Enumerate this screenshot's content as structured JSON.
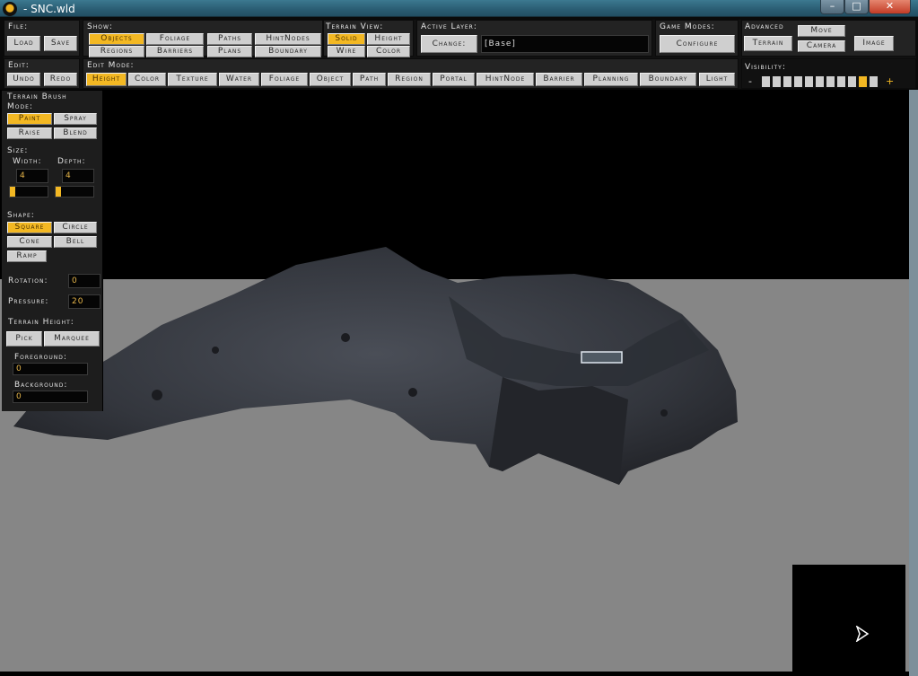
{
  "window": {
    "title": "- SNC.wld",
    "min": "–",
    "max": "□",
    "close": "✕",
    "app_icon": "game-logo-icon"
  },
  "file": {
    "label": "File:",
    "load": "Load",
    "save": "Save"
  },
  "show": {
    "label": "Show:",
    "buttons": [
      "Objects",
      "Foliage",
      "Paths",
      "HintNodes",
      "Regions",
      "Barriers",
      "Plans",
      "Boundary"
    ],
    "active": "Objects"
  },
  "terrain_view": {
    "label": "Terrain View:",
    "buttons": [
      "Solid",
      "Height",
      "Wire",
      "Color"
    ],
    "active": "Solid"
  },
  "active_layer": {
    "label": "Active Layer:",
    "change": "Change:",
    "value": "[Base]"
  },
  "game_modes": {
    "label": "Game Modes:",
    "configure": "Configure"
  },
  "advanced": {
    "label": "Advanced",
    "terrain": "Terrain",
    "move": "Move",
    "camera": "Camera",
    "image": "Image"
  },
  "edit": {
    "label": "Edit:",
    "undo": "Undo",
    "redo": "Redo"
  },
  "edit_mode": {
    "label": "Edit Mode:",
    "buttons": [
      "Height",
      "Color",
      "Texture",
      "Water",
      "Foliage",
      "Object",
      "Path",
      "Region",
      "Portal",
      "HintNode",
      "Barrier",
      "Planning",
      "Boundary",
      "Light"
    ],
    "active": "Height"
  },
  "visibility": {
    "label": "Visibility:",
    "minus": "-",
    "plus": "+",
    "level": 10,
    "steps": 11
  },
  "brush": {
    "title": "Terrain Brush",
    "mode_label": "Mode:",
    "modes": [
      "Paint",
      "Spray",
      "Raise",
      "Blend"
    ],
    "active_mode": "Paint",
    "size_label": "Size:",
    "width_label": "Width:",
    "depth_label": "Depth:",
    "width": "4",
    "depth": "4",
    "shape_label": "Shape:",
    "shapes": [
      "Square",
      "Circle",
      "Cone",
      "Bell",
      "Ramp"
    ],
    "active_shape": "Square",
    "rotation_label": "Rotation:",
    "rotation": "0",
    "pressure_label": "Pressure:",
    "pressure": "20",
    "height_label": "Terrain Height:",
    "pick": "Pick",
    "marquee": "Marquee",
    "fg_label": "Foreground:",
    "fg": "0",
    "bg_label": "Background:",
    "bg": "0"
  },
  "colors": {
    "accent": "#f3b823",
    "ground": "#868686",
    "button": "#cfcfcf"
  }
}
